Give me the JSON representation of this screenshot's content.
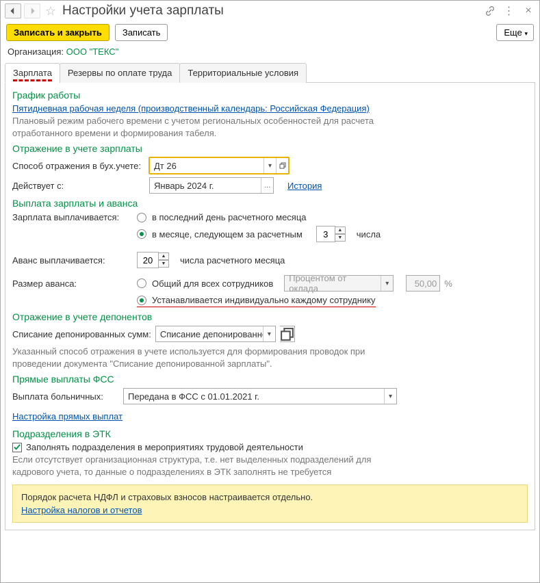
{
  "title": "Настройки учета зарплаты",
  "toolbar": {
    "save_close": "Записать и закрыть",
    "save": "Записать",
    "more": "Еще"
  },
  "org": {
    "label": "Организация:",
    "value": "ООО \"ТЕКС\""
  },
  "tabs": [
    "Зарплата",
    "Резервы по оплате труда",
    "Территориальные условия"
  ],
  "schedule": {
    "title": "График работы",
    "link": "Пятидневная рабочая неделя (производственный календарь: Российская Федерация)",
    "note": "Плановый режим рабочего времени с учетом региональных особенностей для расчета отработанного времени и формирования табеля."
  },
  "acct": {
    "title": "Отражение в учете зарплаты",
    "method_label": "Способ отражения в бух.учете:",
    "method_value": "Дт 26",
    "effective_label": "Действует с:",
    "effective_value": "Январь 2024 г.",
    "history": "История"
  },
  "payout": {
    "title": "Выплата зарплаты и аванса",
    "salary_label": "Зарплата выплачивается:",
    "opt_last": "в последний день расчетного месяца",
    "opt_next": "в месяце, следующем за расчетным",
    "day_value": "3",
    "day_suffix": "числа",
    "advance_label": "Аванс выплачивается:",
    "advance_value": "20",
    "advance_suffix": "числа расчетного месяца",
    "size_label": "Размер аванса:",
    "size_common": "Общий для всех сотрудников",
    "size_combo": "Процентом от оклада",
    "size_pct": "50,00",
    "pct_sign": "%",
    "size_indiv": "Устанавливается индивидуально каждому сотруднику"
  },
  "depon": {
    "title": "Отражение в учете депонентов",
    "label": "Списание депонированных сумм:",
    "value": "Списание депонированно",
    "note": "Указанный способ отражения в учете используется для формирования проводок при проведении документа \"Списание депонированной зарплаты\"."
  },
  "fss": {
    "title": "Прямые выплаты ФСС",
    "label": "Выплата больничных:",
    "value": "Передана в ФСС с 01.01.2021 г.",
    "link": "Настройка прямых выплат"
  },
  "etk": {
    "title": "Подразделения в ЭТК",
    "check": "Заполнять подразделения в мероприятиях трудовой деятельности",
    "note": "Если отсутствует организационная структура, т.е. нет выделенных подразделений для кадрового учета, то данные о подразделениях в ЭТК заполнять не требуется"
  },
  "info": {
    "line": "Порядок расчета НДФЛ и страховых взносов настраивается отдельно.",
    "link": "Настройка налогов и отчетов"
  }
}
